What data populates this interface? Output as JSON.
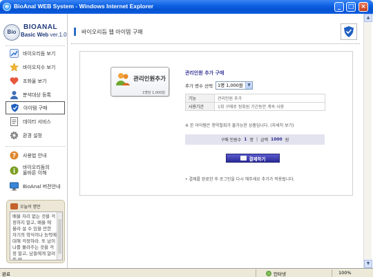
{
  "window": {
    "title": "BioAnal WEB System - Windows Internet Explorer",
    "app_icon_letter": "e",
    "buttons": {
      "minimize": "_",
      "maximize": "□",
      "close": "×"
    }
  },
  "sidebar": {
    "logo_badge": "Bio",
    "logo_main": "BIOANAL",
    "logo_sub_bold": "Basic Web",
    "logo_sub_version": "ver.1.0",
    "menu": [
      {
        "label": "바이오리듬 보기",
        "icon": "biorhythm-icon"
      },
      {
        "label": "바이오지수 보기",
        "icon": "star-icon"
      },
      {
        "label": "조화율 보기",
        "icon": "heart-icon"
      },
      {
        "label": "분석대상 등록",
        "icon": "person-icon"
      },
      {
        "label": "아이템 구매",
        "icon": "shield-icon",
        "active": true
      },
      {
        "label": "데이터 서비스",
        "icon": "document-icon"
      },
      {
        "label": "환경 설정",
        "icon": "gear-icon"
      }
    ],
    "help_menu": [
      {
        "label": "사용법 안내",
        "icon": "question-icon"
      },
      {
        "label": "바이오리듬의 올바른 이해",
        "line1": "바이오리듬의",
        "line2": "올바른 이해",
        "icon": "info-icon"
      },
      {
        "label": "BioAnal 버전안내",
        "icon": "monitor-icon"
      }
    ],
    "notice": {
      "title": "오늘의 명언",
      "text": "배울 자리 없는 것을 걱정하지 말고, 배울 에 올라 설 수 있을 만한 자기의 학식이나 능력에 대해 걱정하라. 또 남이 나를 몰라주는 것을 걱정 말고, 남들에게 알려질 만"
    }
  },
  "main": {
    "page_title": "바이오리듬 웹 아이템 구매",
    "card": {
      "title": "관리인원추가",
      "price": "1명당 1,000원"
    },
    "form": {
      "heading": "관리인원 추가 구매",
      "count_label": "추가 명수 선택",
      "count_value": "1명 1,000원",
      "table": [
        {
          "key": "기능",
          "value": "관리인원 추가"
        },
        {
          "key": "사용기간",
          "value": "1회 구매로 정회원 기간동안 계속 사용"
        }
      ],
      "warning": "※ 본 아이템은 청약철회가 불가능한 상품입니다. (자세히 보기)",
      "summary": {
        "people_label": "구매 인원수",
        "people_value": "1",
        "people_unit": "명",
        "sep": "|",
        "amount_label": "금액",
        "amount_value": "1000",
        "amount_unit": "원"
      },
      "pay_button": "결제하기",
      "note": "• 결제를 완료한 후 로그인을 다시 해주세요 추가가 적용됩니다."
    }
  },
  "statusbar": {
    "left": "완료",
    "zone": "인터넷",
    "zoom": "100%"
  },
  "colors": {
    "accent": "#2c6cc4",
    "pay_button": "#2a2a98",
    "summary_bg": "#e3e3ef"
  }
}
